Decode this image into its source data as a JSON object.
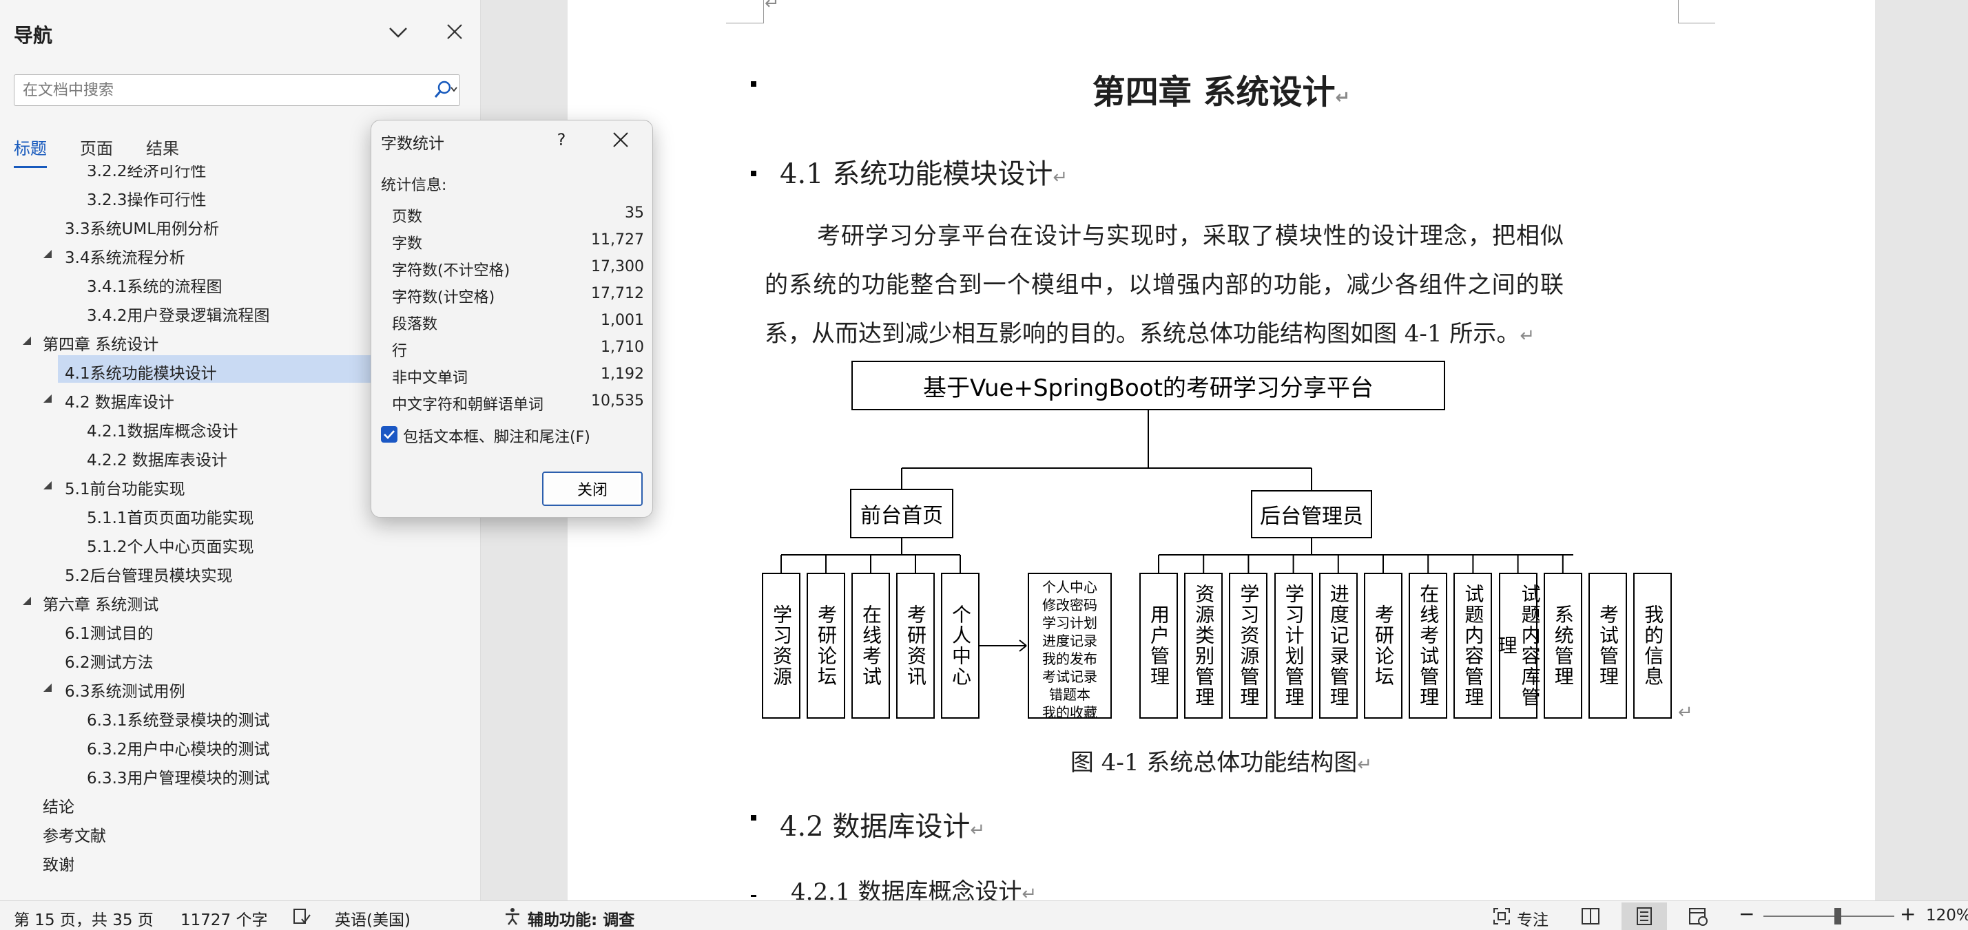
{
  "nav": {
    "title": "导航",
    "search_placeholder": "在文档中搜索",
    "tabs": [
      {
        "label": "标题",
        "active": true
      },
      {
        "label": "页面",
        "active": false
      },
      {
        "label": "结果",
        "active": false
      }
    ],
    "tree": [
      {
        "label": "3.2.2经济可行性",
        "level": 3,
        "expandable": false,
        "selected": false
      },
      {
        "label": "3.2.3操作可行性",
        "level": 3,
        "expandable": false,
        "selected": false
      },
      {
        "label": "3.3系统UML用例分析",
        "level": 2,
        "expandable": false,
        "selected": false
      },
      {
        "label": "3.4系统流程分析",
        "level": 2,
        "expandable": true,
        "selected": false
      },
      {
        "label": "3.4.1系统的流程图",
        "level": 3,
        "expandable": false,
        "selected": false
      },
      {
        "label": "3.4.2用户登录逻辑流程图",
        "level": 3,
        "expandable": false,
        "selected": false
      },
      {
        "label": "第四章 系统设计",
        "level": 1,
        "expandable": true,
        "selected": false
      },
      {
        "label": "4.1系统功能模块设计",
        "level": 2,
        "expandable": false,
        "selected": true
      },
      {
        "label": "4.2 数据库设计",
        "level": 2,
        "expandable": true,
        "selected": false
      },
      {
        "label": "4.2.1数据库概念设计",
        "level": 3,
        "expandable": false,
        "selected": false
      },
      {
        "label": "4.2.2 数据库表设计",
        "level": 3,
        "expandable": false,
        "selected": false
      },
      {
        "label": "5.1前台功能实现",
        "level": 2,
        "expandable": true,
        "selected": false
      },
      {
        "label": "5.1.1首页页面功能实现",
        "level": 3,
        "expandable": false,
        "selected": false
      },
      {
        "label": "5.1.2个人中心页面实现",
        "level": 3,
        "expandable": false,
        "selected": false
      },
      {
        "label": "5.2后台管理员模块实现",
        "level": 2,
        "expandable": false,
        "selected": false
      },
      {
        "label": "第六章 系统测试",
        "level": 1,
        "expandable": true,
        "selected": false
      },
      {
        "label": "6.1测试目的",
        "level": 2,
        "expandable": false,
        "selected": false
      },
      {
        "label": "6.2测试方法",
        "level": 2,
        "expandable": false,
        "selected": false
      },
      {
        "label": "6.3系统测试用例",
        "level": 2,
        "expandable": true,
        "selected": false
      },
      {
        "label": "6.3.1系统登录模块的测试",
        "level": 3,
        "expandable": false,
        "selected": false
      },
      {
        "label": "6.3.2用户中心模块的测试",
        "level": 3,
        "expandable": false,
        "selected": false
      },
      {
        "label": "6.3.3用户管理模块的测试",
        "level": 3,
        "expandable": false,
        "selected": false
      },
      {
        "label": "结论",
        "level": 1,
        "expandable": false,
        "selected": false
      },
      {
        "label": "参考文献",
        "level": 1,
        "expandable": false,
        "selected": false
      },
      {
        "label": "致谢",
        "level": 1,
        "expandable": false,
        "selected": false
      }
    ]
  },
  "dialog": {
    "title": "字数统计",
    "help": "?",
    "stats_heading": "统计信息:",
    "stats": [
      {
        "label": "页数",
        "value": "35"
      },
      {
        "label": "字数",
        "value": "11,727"
      },
      {
        "label": "字符数(不计空格)",
        "value": "17,300"
      },
      {
        "label": "字符数(计空格)",
        "value": "17,712"
      },
      {
        "label": "段落数",
        "value": "1,001"
      },
      {
        "label": "行",
        "value": "1,710"
      },
      {
        "label": "非中文单词",
        "value": "1,192"
      },
      {
        "label": "中文字符和朝鲜语单词",
        "value": "10,535"
      }
    ],
    "checkbox_label": "包括文本框、脚注和尾注(F)",
    "checkbox_checked": true,
    "close_label": "关闭"
  },
  "doc": {
    "chapter_title": "第四章  系统设计",
    "section1": "4.1 系统功能模块设计",
    "paragraph": "考研学习分享平台在设计与实现时，采取了模块性的设计理念，把相似的系统的功能整合到一个模组中，以增强内部的功能，减少各组件之间的联系，从而达到减少相互影响的目的。系统总体功能结构图如图 4-1 所示。",
    "diagram": {
      "root": "基于Vue+SpringBoot的考研学习分享平台",
      "left_branch": "前台首页",
      "right_branch": "后台管理员",
      "left_leaves": [
        "学习资源",
        "考研论坛",
        "在线考试",
        "考研资讯",
        "个人中心"
      ],
      "personal_center_items": "个人中心\n修改密码\n学习计划\n进度记录\n我的发布\n考试记录\n错题本\n我的收藏",
      "right_leaves": [
        "用户管理",
        "资源类别管理",
        "学习资源管理",
        "学习计划管理",
        "进度记录管理",
        "考研论坛",
        "在线考试管理",
        "试题内容管理",
        "试题内容库管理",
        "系统管理",
        "考试管理",
        "我的信息"
      ]
    },
    "figure_caption": "图 4-1  系统总体功能结构图",
    "section2": "4.2  数据库设计",
    "section3": "4.2.1 数据库概念设计",
    "para_mark": "↵"
  },
  "status": {
    "page_info": "第 15 页，共 35 页",
    "word_count": "11727 个字",
    "language": "英语(美国)",
    "accessibility": "辅助功能: 调查",
    "focus": "专注",
    "zoom_minus": "−",
    "zoom_plus": "+",
    "zoom": "120%",
    "zoom_level": 0.57
  }
}
